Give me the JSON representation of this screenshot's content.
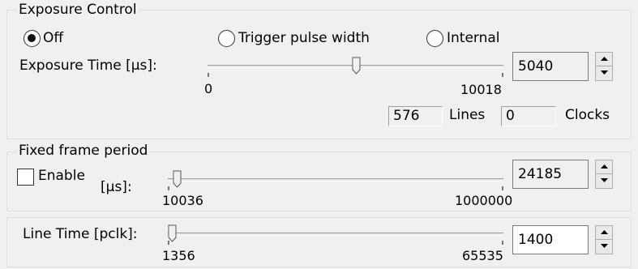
{
  "exposure_control": {
    "title": "Exposure Control",
    "mode_options": [
      {
        "label": "Off",
        "selected": true
      },
      {
        "label": "Trigger pulse width",
        "selected": false
      },
      {
        "label": "Internal",
        "selected": false
      }
    ],
    "exposure_time": {
      "label": "Exposure Time [µs]:",
      "min_label": "0",
      "max_label": "10018",
      "value": "5040",
      "slider_fraction": 0.503
    },
    "lines_value": "576",
    "lines_label": "Lines",
    "clocks_value": "0",
    "clocks_label": "Clocks"
  },
  "fixed_frame_period": {
    "title": "Fixed frame period",
    "enable_label": "Enable",
    "enabled": false,
    "unit_label": "[µs]:",
    "min_label": "10036",
    "max_label": "1000000",
    "value": "24185",
    "slider_fraction": 0.014
  },
  "line_time": {
    "label": "Line Time [pclk]:",
    "min_label": "1356",
    "max_label": "65535",
    "value": "1400",
    "slider_fraction": 0.0007
  },
  "icons": {
    "spin_up": "triangle-up-icon",
    "spin_down": "triangle-down-icon"
  },
  "colors": {
    "group_border": "#d5dfe5",
    "background": "#f0f0f0"
  }
}
